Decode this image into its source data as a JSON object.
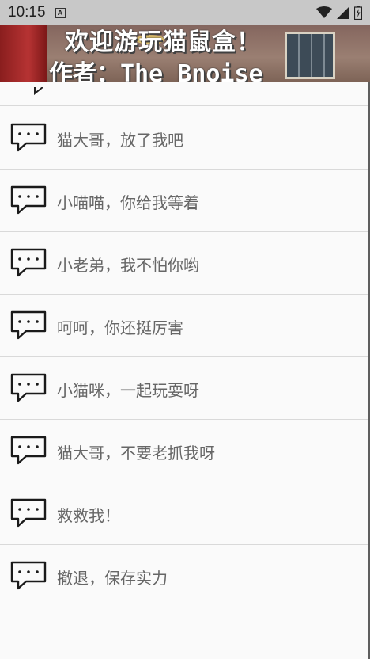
{
  "status_bar": {
    "time": "10:15",
    "notification_glyph": "A",
    "icons": [
      "wifi-icon",
      "signal-icon",
      "battery-icon"
    ]
  },
  "banner": {
    "title": "欢迎游玩猫鼠盒！",
    "author": "作者：The_Bnoise"
  },
  "menu": {
    "items": [
      {
        "label": "猫大哥，放了我吧",
        "icon": "speech-bubble-icon"
      },
      {
        "label": "小喵喵，你给我等着",
        "icon": "speech-bubble-icon"
      },
      {
        "label": "小老弟，我不怕你哟",
        "icon": "speech-bubble-icon"
      },
      {
        "label": "呵呵，你还挺厉害",
        "icon": "speech-bubble-icon"
      },
      {
        "label": "小猫咪，一起玩耍呀",
        "icon": "speech-bubble-icon"
      },
      {
        "label": "猫大哥，不要老抓我呀",
        "icon": "speech-bubble-icon"
      },
      {
        "label": "救救我！",
        "icon": "speech-bubble-icon"
      },
      {
        "label": "撤退，保存实力",
        "icon": "speech-bubble-icon"
      }
    ]
  },
  "colors": {
    "list_background": "#fafafa",
    "divider": "#d9d9d9",
    "label_text": "#666666",
    "status_bar": "#c8c8c8"
  }
}
